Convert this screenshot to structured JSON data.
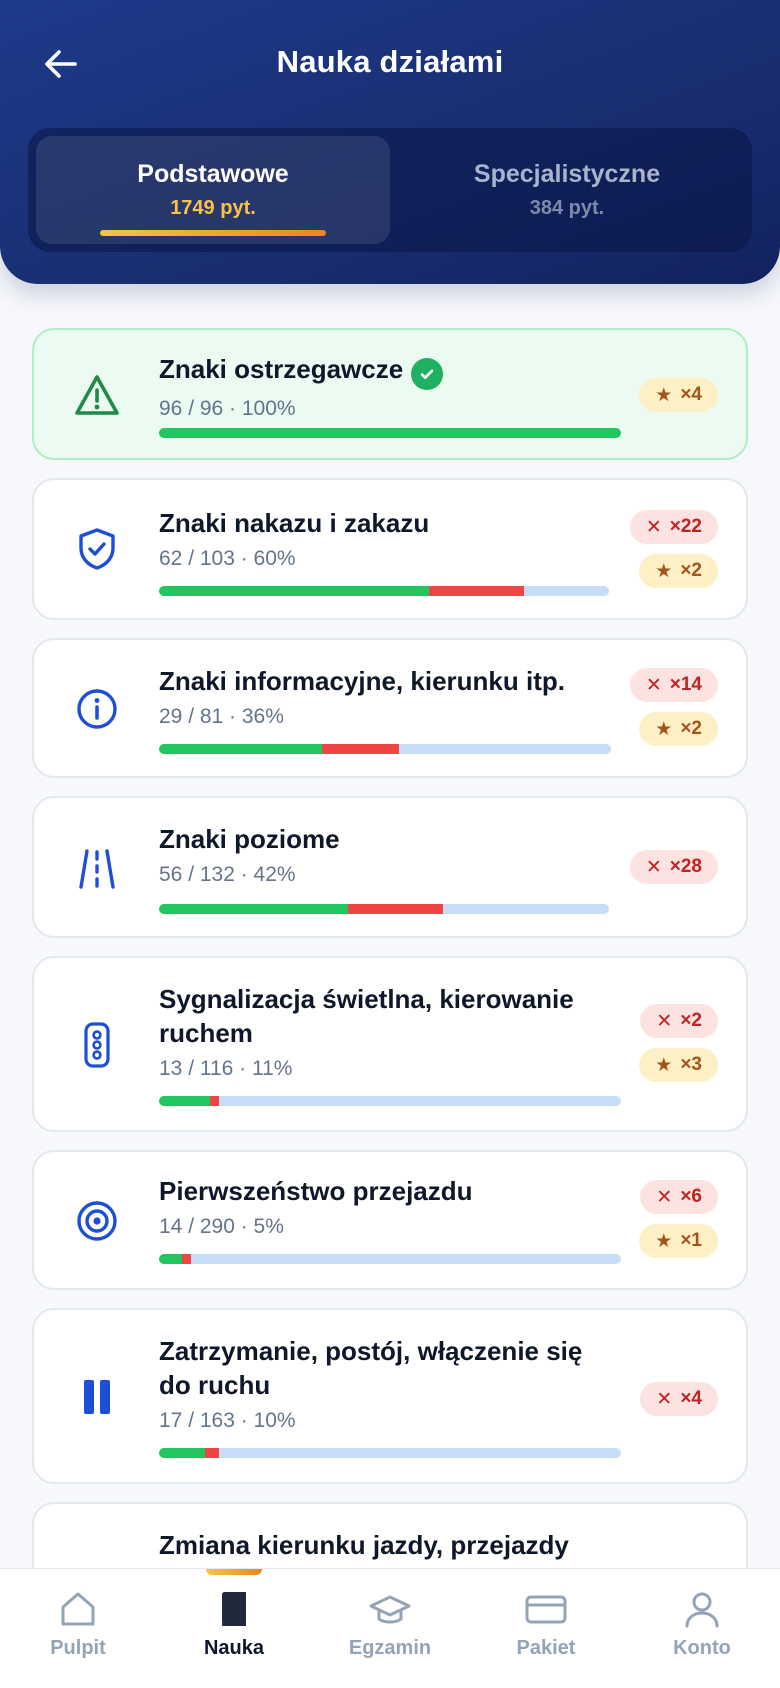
{
  "header": {
    "title": "Nauka działami",
    "tabs": [
      {
        "label": "Podstawowe",
        "count": "1749 pyt."
      },
      {
        "label": "Specjalistyczne",
        "count": "384 pyt."
      }
    ]
  },
  "colors": {
    "header_bg": "#1a2f73",
    "accent": "#f6c34a",
    "correct": "#22c55e",
    "wrong": "#ef4444",
    "remaining": "#c7dcf7",
    "icon_blue": "#1d4ed8"
  },
  "sections": [
    {
      "icon": "warning-triangle-icon",
      "title": "Znaki ostrzegawcze",
      "stats": "96 / 96 · 100%",
      "completed": true,
      "progress": {
        "correct": 100,
        "wrong": 0
      },
      "errors": null,
      "stars": "×4"
    },
    {
      "icon": "shield-check-icon",
      "title": "Znaki nakazu i zakazu",
      "stats": "62 / 103 · 60%",
      "completed": false,
      "progress": {
        "correct": 60,
        "wrong": 21
      },
      "errors": "×22",
      "stars": "×2"
    },
    {
      "icon": "info-icon",
      "title": "Znaki informacyjne, kierunku itp.",
      "stats": "29 / 81 · 36%",
      "completed": false,
      "progress": {
        "correct": 36,
        "wrong": 17
      },
      "errors": "×14",
      "stars": "×2"
    },
    {
      "icon": "road-lanes-icon",
      "title": "Znaki poziome",
      "stats": "56 / 132 · 42%",
      "completed": false,
      "progress": {
        "correct": 42,
        "wrong": 21
      },
      "errors": "×28",
      "stars": null
    },
    {
      "icon": "traffic-light-icon",
      "title": "Sygnalizacja świetlna, kierowanie ruchem",
      "stats": "13 / 116 · 11%",
      "completed": false,
      "progress": {
        "correct": 11,
        "wrong": 2
      },
      "errors": "×2",
      "stars": "×3"
    },
    {
      "icon": "target-icon",
      "title": "Pierwszeństwo przejazdu",
      "stats": "14 / 290 · 5%",
      "completed": false,
      "progress": {
        "correct": 5,
        "wrong": 2
      },
      "errors": "×6",
      "stars": "×1"
    },
    {
      "icon": "pause-icon",
      "title": "Zatrzymanie, postój, włączenie się do ruchu",
      "stats": "17 / 163 · 10%",
      "completed": false,
      "progress": {
        "correct": 10,
        "wrong": 3
      },
      "errors": "×4",
      "stars": null
    },
    {
      "icon": "",
      "title": "Zmiana kierunku jazdy, przejazdy",
      "stats": "",
      "completed": false,
      "progress": null,
      "errors": null,
      "stars": null
    }
  ],
  "bottom_nav": [
    {
      "icon": "home-icon",
      "label": "Pulpit",
      "active": false
    },
    {
      "icon": "book-icon",
      "label": "Nauka",
      "active": true
    },
    {
      "icon": "graduation-cap-icon",
      "label": "Egzamin",
      "active": false
    },
    {
      "icon": "card-icon",
      "label": "Pakiet",
      "active": false
    },
    {
      "icon": "user-icon",
      "label": "Konto",
      "active": false
    }
  ]
}
